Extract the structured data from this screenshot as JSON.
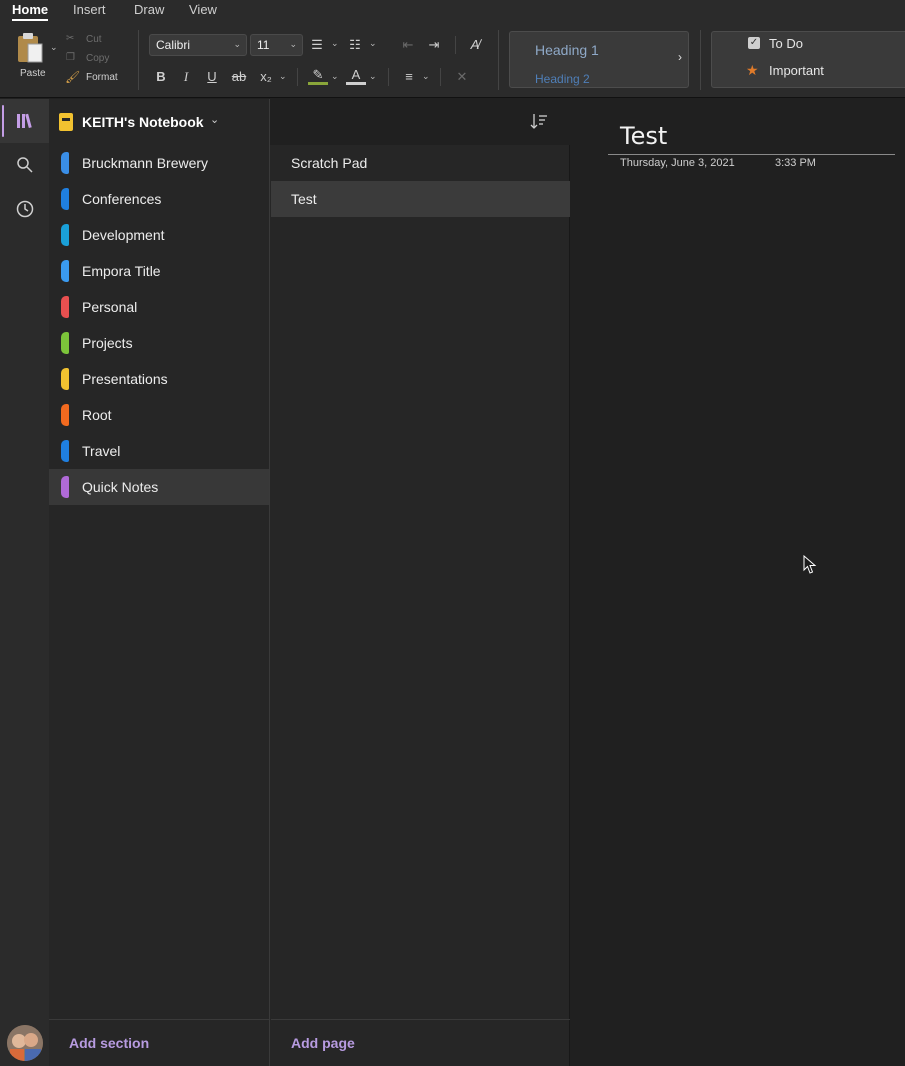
{
  "ribbon_tabs": [
    "Home",
    "Insert",
    "Draw",
    "View"
  ],
  "clipboard": {
    "paste_label": "Paste",
    "cut_label": "Cut",
    "copy_label": "Copy",
    "format_label": "Format"
  },
  "font": {
    "family": "Calibri",
    "size": "11"
  },
  "styles": {
    "heading1": "Heading 1",
    "heading2": "Heading 2"
  },
  "tags": {
    "todo": "To Do",
    "important": "Important"
  },
  "notebook": {
    "name": "KEITH's Notebook"
  },
  "sections": [
    {
      "label": "Bruckmann Brewery",
      "color": "#3a8ee6"
    },
    {
      "label": "Conferences",
      "color": "#1f7fe0"
    },
    {
      "label": "Development",
      "color": "#1aa0d8"
    },
    {
      "label": "Empora Title",
      "color": "#3a9af0"
    },
    {
      "label": "Personal",
      "color": "#e85050"
    },
    {
      "label": "Projects",
      "color": "#7cc43a"
    },
    {
      "label": "Presentations",
      "color": "#f2c230"
    },
    {
      "label": "Root",
      "color": "#f26a1f"
    },
    {
      "label": "Travel",
      "color": "#1f7fe0"
    },
    {
      "label": "Quick Notes",
      "color": "#b06ad8"
    }
  ],
  "pages": [
    {
      "label": "Scratch Pad"
    },
    {
      "label": "Test"
    }
  ],
  "footer": {
    "add_section": "Add section",
    "add_page": "Add page"
  },
  "note": {
    "title": "Test",
    "date": "Thursday, June 3, 2021",
    "time": "3:33 PM"
  },
  "colors": {
    "accent": "#b79be0",
    "background": "#202020"
  }
}
